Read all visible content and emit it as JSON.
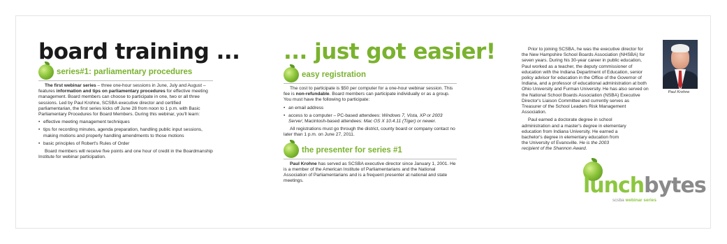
{
  "col1": {
    "heading": "board training ...",
    "section_title": "series#1: parliamentary procedures",
    "intro_lead": "The first webinar series",
    "intro_text_1": " – three one-hour sessions in June, July and August – features ",
    "intro_bold": "information and tips on parliamentary procedures",
    "intro_text_2": " for effective meeting management. Board members can choose to participate in one, two or all three sessions. Led by Paul Krohne, SCSBA executive director and certified parliamentarian, the first series kicks off June 28 from noon to 1 p.m. with Basic Parliamentary Procedures for Board Members. During this webinar, you'll learn:",
    "bullets": [
      "effective meeting management techniques",
      "tips for recording minutes, agenda preparation, handling public input sessions, making motions and properly handling amendments to those motions",
      "basic principles of Robert's Rules of Order"
    ],
    "closing": "Board members will receive five points and one hour of credit in the Boardmanship Institute for webinar participation."
  },
  "col2": {
    "heading": "... just got easier!",
    "reg_title": "easy registration",
    "reg_text_1": "The cost to participate is $50 per computer for a one-hour webinar session. This fee is ",
    "reg_bold": "non-refundable",
    "reg_text_2": ". Board members can participate individually or as a group. You must have the following to participate:",
    "bullet_1": "an email address",
    "bullet_2_a": "access to a computer – PC-based attendees: ",
    "bullet_2_i1": "Windows 7, Vista, XP or 2003 Server",
    "bullet_2_b": "; Macintosh-based attendees: ",
    "bullet_2_i2": "Mac OS X 10.4.11 (Tiger) or newer.",
    "reg_closing": "All registrations must go through the district, county board or company contact no later than 1 p.m. on June 27, 2011.",
    "presenter_title": "the presenter for series #1",
    "presenter_lead": "Paul Krohne",
    "presenter_text": " has served as SCSBA executive director since January 1, 2001. He is a member of the American Institute of Parliamentarians and the National Association of Parliamentarians and is a frequent presenter at national and state meetings."
  },
  "col3": {
    "photo_caption": "Paul Krohne",
    "bio_1": "Prior to joining SCSBA, he was the executive director for the New Hampshire School Boards Association (NHSBA) for seven years. During his 30-year career in public education, Paul worked as a teacher, the deputy commissioner of education with the Indiana Department of Education, senior policy advisor for education in the Office of the Governor of Indiana, and a professor of educational administration at both Ohio University and Furman University. He has also served on the National School Boards Association (NSBA) Executive Director's Liaison Committee and currently serves as Treasurer of the School Leaders Risk Management Association.",
    "bio_2": "Paul earned a doctorate degree in school administration and a master's degree in elementary education from Indiana University. He earned a bachelor's degree in elementary education from the University of Evansville. ",
    "bio_2_italic": "He is the 2003 recipient of the Shannon Award."
  },
  "logo": {
    "word_green": "lunch",
    "word_gray": "bytes",
    "sub_org": "scsba",
    "sub_series": "webinar series"
  }
}
